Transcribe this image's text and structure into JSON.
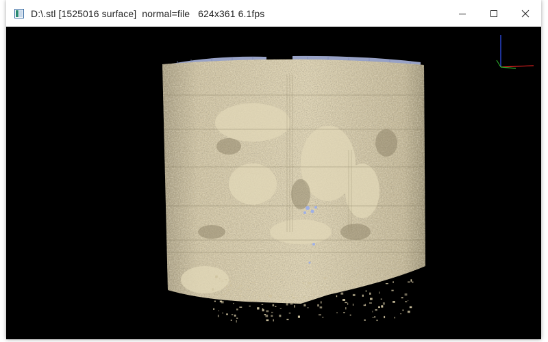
{
  "window": {
    "title": "D:\\.stl [1525016 surface]  normal=file   624x361 6.1fps",
    "icon": "viewer-app-icon",
    "controls": {
      "minimize": "minimize-icon",
      "maximize": "maximize-icon",
      "close": "close-icon"
    }
  },
  "viewport": {
    "background": "#000000",
    "surface_color": "#d2c6a3",
    "inner_color": "#9aa8d6",
    "axis_colors": {
      "x": "#e02020",
      "y": "#2fb82f",
      "z": "#3355ff"
    }
  }
}
